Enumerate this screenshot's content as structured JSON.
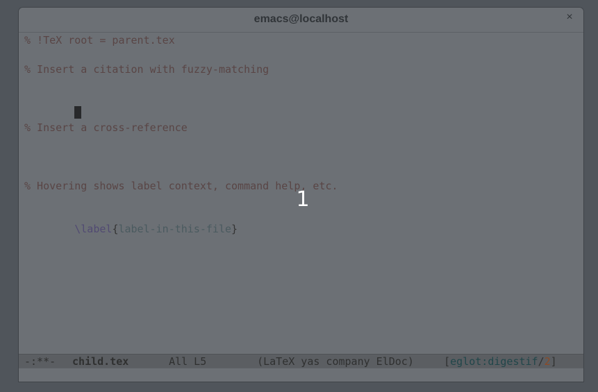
{
  "window": {
    "title": "emacs@localhost",
    "close_label": "×"
  },
  "editor": {
    "lines": [
      "% !TeX root = parent.tex",
      "% Insert a citation with fuzzy-matching",
      "% Insert a cross-reference",
      "% Hovering shows label context, command help, etc.",
      "\\label",
      "{",
      "label-in-this-file",
      "}"
    ],
    "overlay_number": "1"
  },
  "modeline": {
    "state": "-:**-",
    "buffer": "child.tex",
    "position": "All L5",
    "modes": "(LaTeX yas company ElDoc)",
    "lsp_open": "[",
    "lsp_server": "eglot:digestif",
    "lsp_sep": "/",
    "lsp_count": "2",
    "lsp_close": "]"
  },
  "colors": {
    "background": "#6c7075",
    "comment": "#594545",
    "command": "#514a72",
    "cursor": "#28292b"
  }
}
